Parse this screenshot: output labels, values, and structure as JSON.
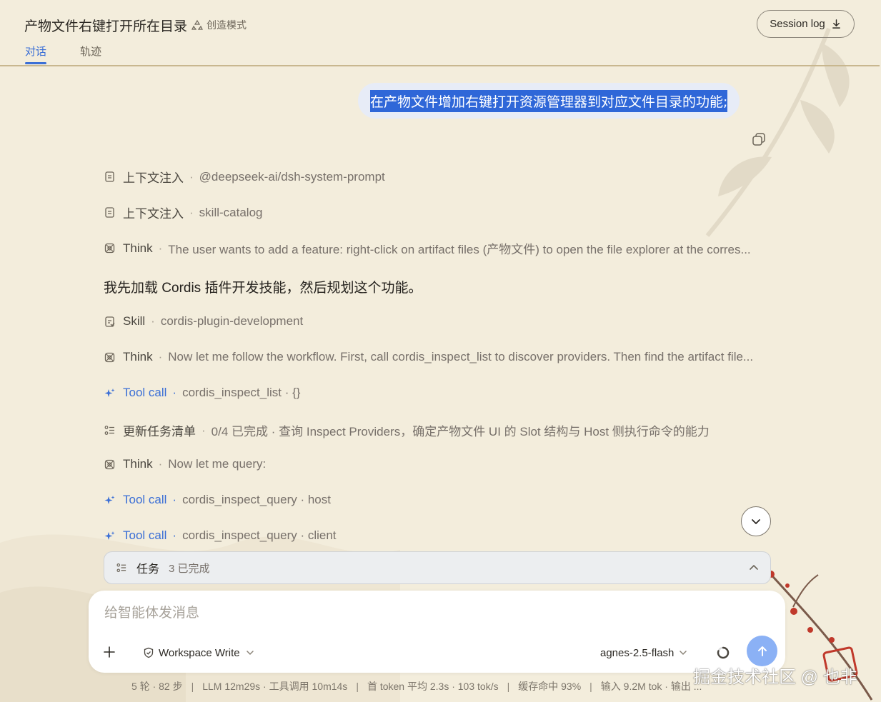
{
  "header": {
    "title": "产物文件右键打开所在目录",
    "mode_label": "创造模式",
    "session_log_label": "Session log",
    "tabs": [
      {
        "label": "对话",
        "active": true
      },
      {
        "label": "轨迹",
        "active": false
      }
    ]
  },
  "user_message": "在产物文件增加右键打开资源管理器到对应文件目录的功能;",
  "timeline": [
    {
      "icon": "document-icon",
      "label": "上下文注入",
      "desc": "@deepseek-ai/dsh-system-prompt"
    },
    {
      "icon": "document-icon",
      "label": "上下文注入",
      "desc": "skill-catalog"
    },
    {
      "icon": "brain-icon",
      "label": "Think",
      "desc": "The user wants to add a feature: right-click on artifact files (产物文件) to open the file explorer at the corres..."
    },
    {
      "icon": "skill-icon",
      "label": "Skill",
      "desc": "cordis-plugin-development"
    },
    {
      "icon": "brain-icon",
      "label": "Think",
      "desc": "Now let me follow the workflow. First, call cordis_inspect_list to discover providers. Then find the artifact file..."
    },
    {
      "icon": "sparkle-icon",
      "label": "Tool call",
      "desc": "cordis_inspect_list · {}"
    },
    {
      "icon": "checklist-icon",
      "label": "更新任务清单",
      "desc": "0/4 已完成 · 查询 Inspect Providers，确定产物文件 UI 的 Slot 结构与 Host 侧执行命令的能力"
    },
    {
      "icon": "brain-icon",
      "label": "Think",
      "desc": "Now let me query:"
    },
    {
      "icon": "sparkle-icon",
      "label": "Tool call",
      "desc": "cordis_inspect_query · host"
    },
    {
      "icon": "sparkle-icon",
      "label": "Tool call",
      "desc": "cordis_inspect_query · client"
    }
  ],
  "assistant_text": "我先加载 Cordis 插件开发技能，然后规划这个功能。",
  "task_bar": {
    "label": "任务",
    "count": "3 已完成"
  },
  "composer": {
    "placeholder": "给智能体发消息",
    "value": "",
    "workspace_label": "Workspace Write",
    "model_label": "agnes-2.5-flash"
  },
  "stats": [
    "5 轮 · 82 步",
    "LLM 12m29s · 工具调用 10m14s",
    "首 token 平均 2.3s · 103 tok/s",
    "缓存命中 93%",
    "输入 9.2M tok · 输出 ..."
  ],
  "watermark": "掘金技术社区 @ 也非",
  "colors": {
    "accent": "#3b6fd6",
    "background": "#f3eddc",
    "selection": "#2f67d8",
    "send": "#8bb1f5"
  }
}
